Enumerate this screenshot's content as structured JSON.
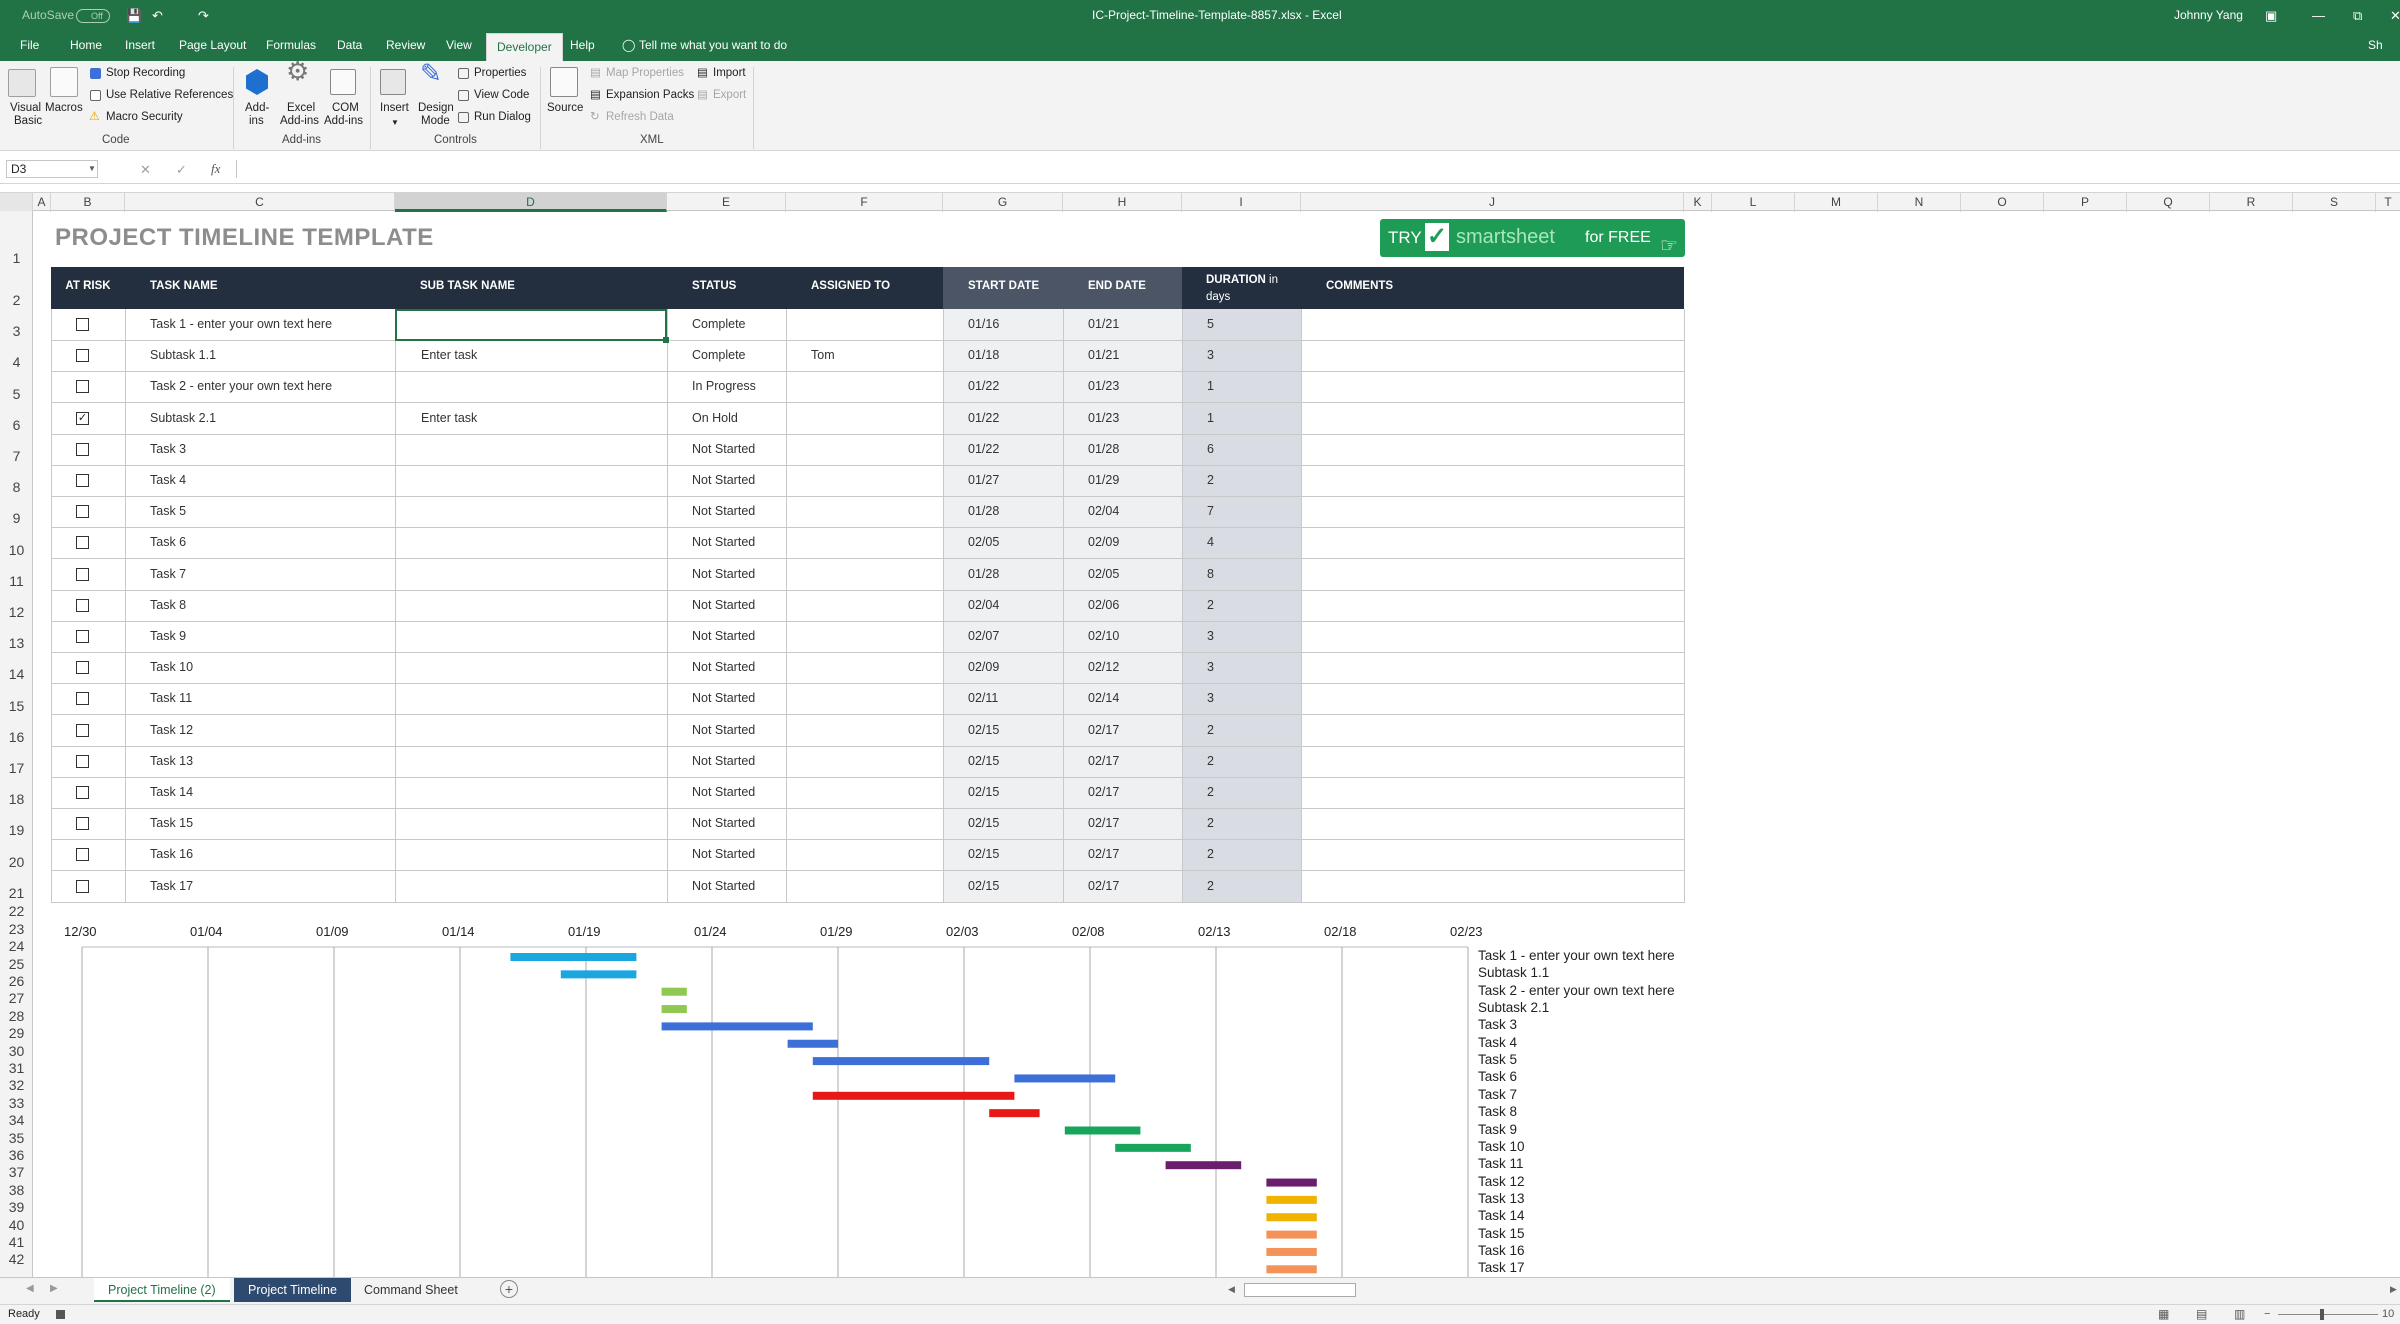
{
  "window": {
    "title": "IC-Project-Timeline-Template-8857.xlsx  -  Excel",
    "user": "Johnny Yang",
    "autosave_label": "AutoSave",
    "autosave_state": "Off",
    "share": "Sh"
  },
  "menu": {
    "tabs": [
      "File",
      "Home",
      "Insert",
      "Page Layout",
      "Formulas",
      "Data",
      "Review",
      "View",
      "Developer",
      "Help"
    ],
    "active": "Developer",
    "tell_me": "Tell me what you want to do"
  },
  "ribbon": {
    "code": {
      "visual_basic": [
        "Visual",
        "Basic"
      ],
      "macros": "Macros",
      "stop_recording": "Stop Recording",
      "relative_refs": "Use Relative References",
      "macro_security": "Macro Security",
      "group": "Code"
    },
    "addins": {
      "addins": [
        "Add-",
        "ins"
      ],
      "excel_addins": [
        "Excel",
        "Add-ins"
      ],
      "com_addins": [
        "COM",
        "Add-ins"
      ],
      "group": "Add-ins"
    },
    "controls": {
      "insert": "Insert",
      "design_mode": [
        "Design",
        "Mode"
      ],
      "properties": "Properties",
      "view_code": "View Code",
      "run_dialog": "Run Dialog",
      "group": "Controls"
    },
    "xml": {
      "source": "Source",
      "map_properties": "Map Properties",
      "expansion_packs": "Expansion Packs",
      "refresh_data": "Refresh Data",
      "import": "Import",
      "export": "Export",
      "group": "XML"
    }
  },
  "formula_bar": {
    "name_box": "D3",
    "fx": "fx",
    "value": ""
  },
  "columns": [
    "A",
    "B",
    "C",
    "D",
    "E",
    "F",
    "G",
    "H",
    "I",
    "J",
    "K",
    "L",
    "M",
    "N",
    "O",
    "P",
    "Q",
    "R",
    "S",
    "T"
  ],
  "rows": [
    "1",
    "2",
    "3",
    "4",
    "5",
    "6",
    "7",
    "8",
    "9",
    "10",
    "11",
    "12",
    "13",
    "14",
    "15",
    "16",
    "17",
    "18",
    "19",
    "20",
    "21",
    "22",
    "23",
    "24",
    "25",
    "26",
    "27",
    "28",
    "29",
    "30",
    "31",
    "32",
    "33",
    "34",
    "35",
    "36",
    "37",
    "38",
    "39",
    "40",
    "41",
    "42"
  ],
  "sheet": {
    "title": "PROJECT TIMELINE TEMPLATE",
    "promo": {
      "try": "TRY",
      "brand": "smartsheet",
      "for_free": "for FREE"
    },
    "headers": {
      "at_risk": "AT RISK",
      "task_name": "TASK NAME",
      "sub_task": "SUB TASK NAME",
      "status": "STATUS",
      "assigned": "ASSIGNED TO",
      "start": "START DATE",
      "end": "END DATE",
      "duration": "DURATION",
      "duration_unit": "in",
      "duration_unit2": "days",
      "comments": "COMMENTS"
    },
    "tasks": [
      {
        "risk": false,
        "task": "Task 1 - enter your own text here",
        "sub": "",
        "status": "Complete",
        "assigned": "",
        "start": "01/16",
        "end": "01/21",
        "dur": "5"
      },
      {
        "risk": false,
        "task": "Subtask 1.1",
        "sub": "Enter task",
        "status": "Complete",
        "assigned": "Tom",
        "start": "01/18",
        "end": "01/21",
        "dur": "3"
      },
      {
        "risk": false,
        "task": "Task 2 - enter your own text here",
        "sub": "",
        "status": "In Progress",
        "assigned": "",
        "start": "01/22",
        "end": "01/23",
        "dur": "1"
      },
      {
        "risk": true,
        "task": "Subtask 2.1",
        "sub": "Enter task",
        "status": "On Hold",
        "assigned": "",
        "start": "01/22",
        "end": "01/23",
        "dur": "1"
      },
      {
        "risk": false,
        "task": "Task 3",
        "sub": "",
        "status": "Not Started",
        "assigned": "",
        "start": "01/22",
        "end": "01/28",
        "dur": "6"
      },
      {
        "risk": false,
        "task": "Task 4",
        "sub": "",
        "status": "Not Started",
        "assigned": "",
        "start": "01/27",
        "end": "01/29",
        "dur": "2"
      },
      {
        "risk": false,
        "task": "Task 5",
        "sub": "",
        "status": "Not Started",
        "assigned": "",
        "start": "01/28",
        "end": "02/04",
        "dur": "7"
      },
      {
        "risk": false,
        "task": "Task 6",
        "sub": "",
        "status": "Not Started",
        "assigned": "",
        "start": "02/05",
        "end": "02/09",
        "dur": "4"
      },
      {
        "risk": false,
        "task": "Task 7",
        "sub": "",
        "status": "Not Started",
        "assigned": "",
        "start": "01/28",
        "end": "02/05",
        "dur": "8"
      },
      {
        "risk": false,
        "task": "Task 8",
        "sub": "",
        "status": "Not Started",
        "assigned": "",
        "start": "02/04",
        "end": "02/06",
        "dur": "2"
      },
      {
        "risk": false,
        "task": "Task 9",
        "sub": "",
        "status": "Not Started",
        "assigned": "",
        "start": "02/07",
        "end": "02/10",
        "dur": "3"
      },
      {
        "risk": false,
        "task": "Task 10",
        "sub": "",
        "status": "Not Started",
        "assigned": "",
        "start": "02/09",
        "end": "02/12",
        "dur": "3"
      },
      {
        "risk": false,
        "task": "Task 11",
        "sub": "",
        "status": "Not Started",
        "assigned": "",
        "start": "02/11",
        "end": "02/14",
        "dur": "3"
      },
      {
        "risk": false,
        "task": "Task 12",
        "sub": "",
        "status": "Not Started",
        "assigned": "",
        "start": "02/15",
        "end": "02/17",
        "dur": "2"
      },
      {
        "risk": false,
        "task": "Task 13",
        "sub": "",
        "status": "Not Started",
        "assigned": "",
        "start": "02/15",
        "end": "02/17",
        "dur": "2"
      },
      {
        "risk": false,
        "task": "Task 14",
        "sub": "",
        "status": "Not Started",
        "assigned": "",
        "start": "02/15",
        "end": "02/17",
        "dur": "2"
      },
      {
        "risk": false,
        "task": "Task 15",
        "sub": "",
        "status": "Not Started",
        "assigned": "",
        "start": "02/15",
        "end": "02/17",
        "dur": "2"
      },
      {
        "risk": false,
        "task": "Task 16",
        "sub": "",
        "status": "Not Started",
        "assigned": "",
        "start": "02/15",
        "end": "02/17",
        "dur": "2"
      },
      {
        "risk": false,
        "task": "Task 17",
        "sub": "",
        "status": "Not Started",
        "assigned": "",
        "start": "02/15",
        "end": "02/17",
        "dur": "2"
      }
    ]
  },
  "chart_data": {
    "type": "bar",
    "subtype": "gantt",
    "x_ticks": [
      "12/30",
      "01/04",
      "01/09",
      "01/14",
      "01/19",
      "01/24",
      "01/29",
      "02/03",
      "02/08",
      "02/13",
      "02/18",
      "02/23"
    ],
    "categories": [
      "Task 1 - enter your own text here",
      "Subtask 1.1",
      "Task 2 - enter your own text here",
      "Subtask 2.1",
      "Task 3",
      "Task 4",
      "Task 5",
      "Task 6",
      "Task 7",
      "Task 8",
      "Task 9",
      "Task 10",
      "Task 11",
      "Task 12",
      "Task 13",
      "Task 14",
      "Task 15",
      "Task 16",
      "Task 17"
    ],
    "starts": [
      "01/16",
      "01/18",
      "01/22",
      "01/22",
      "01/22",
      "01/27",
      "01/28",
      "02/05",
      "01/28",
      "02/04",
      "02/07",
      "02/09",
      "02/11",
      "02/15",
      "02/15",
      "02/15",
      "02/15",
      "02/15",
      "02/15"
    ],
    "durations": [
      5,
      3,
      1,
      1,
      6,
      2,
      7,
      4,
      8,
      2,
      3,
      3,
      3,
      2,
      2,
      2,
      2,
      2,
      2
    ],
    "colors": [
      "#1aa7e0",
      "#1aa7e0",
      "#8fc852",
      "#8fc852",
      "#3c6fd8",
      "#3c6fd8",
      "#3c6fd8",
      "#3c6fd8",
      "#e81818",
      "#e81818",
      "#17a55b",
      "#17a55b",
      "#6b1d6e",
      "#6b1d6e",
      "#f0b400",
      "#f0b400",
      "#f3935a",
      "#f3935a",
      "#f3935a"
    ],
    "grid": true,
    "legend": "none"
  },
  "sheet_tabs": [
    "Project Timeline (2)",
    "Project Timeline",
    "Command Sheet"
  ],
  "active_tab": "Project Timeline (2)",
  "status": {
    "ready": "Ready",
    "zoom": "10"
  }
}
